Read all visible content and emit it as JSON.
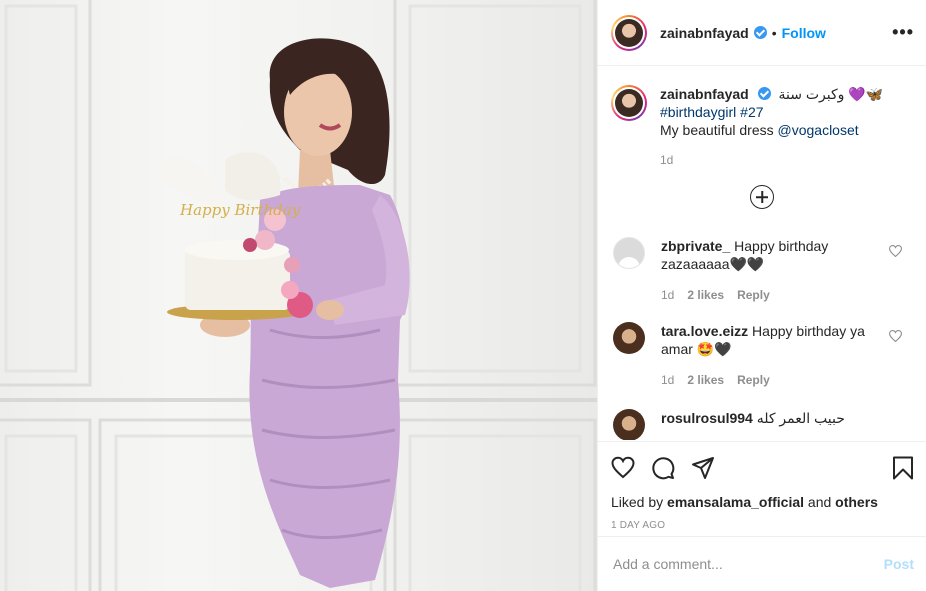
{
  "post": {
    "username": "zainabnfayad",
    "follow_label": "Follow",
    "more_label": "•••",
    "separator": "•",
    "caption": {
      "username": "zainabnfayad",
      "arabic_text": "وكبرت سنة",
      "emojis": "💜🦋",
      "hashtags": "#birthdaygirl #27",
      "line3_text": "My beautiful dress ",
      "line3_mention": "@vogacloset",
      "time": "1d"
    },
    "photo": {
      "cake_topper_text": "Happy Birthday"
    },
    "comments": [
      {
        "username": "zbprivate_",
        "text": "Happy birthday zazaaaaaa🖤🖤",
        "time": "1d",
        "likes": "2 likes",
        "reply": "Reply",
        "avatar": "default-avatar"
      },
      {
        "username": "tara.love.eizz",
        "text": "Happy birthday ya amar 🤩🖤",
        "time": "1d",
        "likes": "2 likes",
        "reply": "Reply",
        "avatar": "photo-avatar"
      },
      {
        "username": "rosulrosul994",
        "text": "حبيب العمر كله",
        "avatar": "photo-avatar"
      }
    ],
    "actions": {
      "liked_prefix": "Liked by ",
      "liked_user": "emansalama_official",
      "liked_and": " and ",
      "liked_others": "others",
      "timestamp": "1 DAY AGO"
    },
    "add_comment": {
      "placeholder": "Add a comment...",
      "post_label": "Post"
    },
    "colors": {
      "follow_blue": "#0095f6",
      "verified_blue": "#3897f0",
      "post_disabled": "#b2dffc",
      "dress": "#c9a8d6"
    }
  }
}
